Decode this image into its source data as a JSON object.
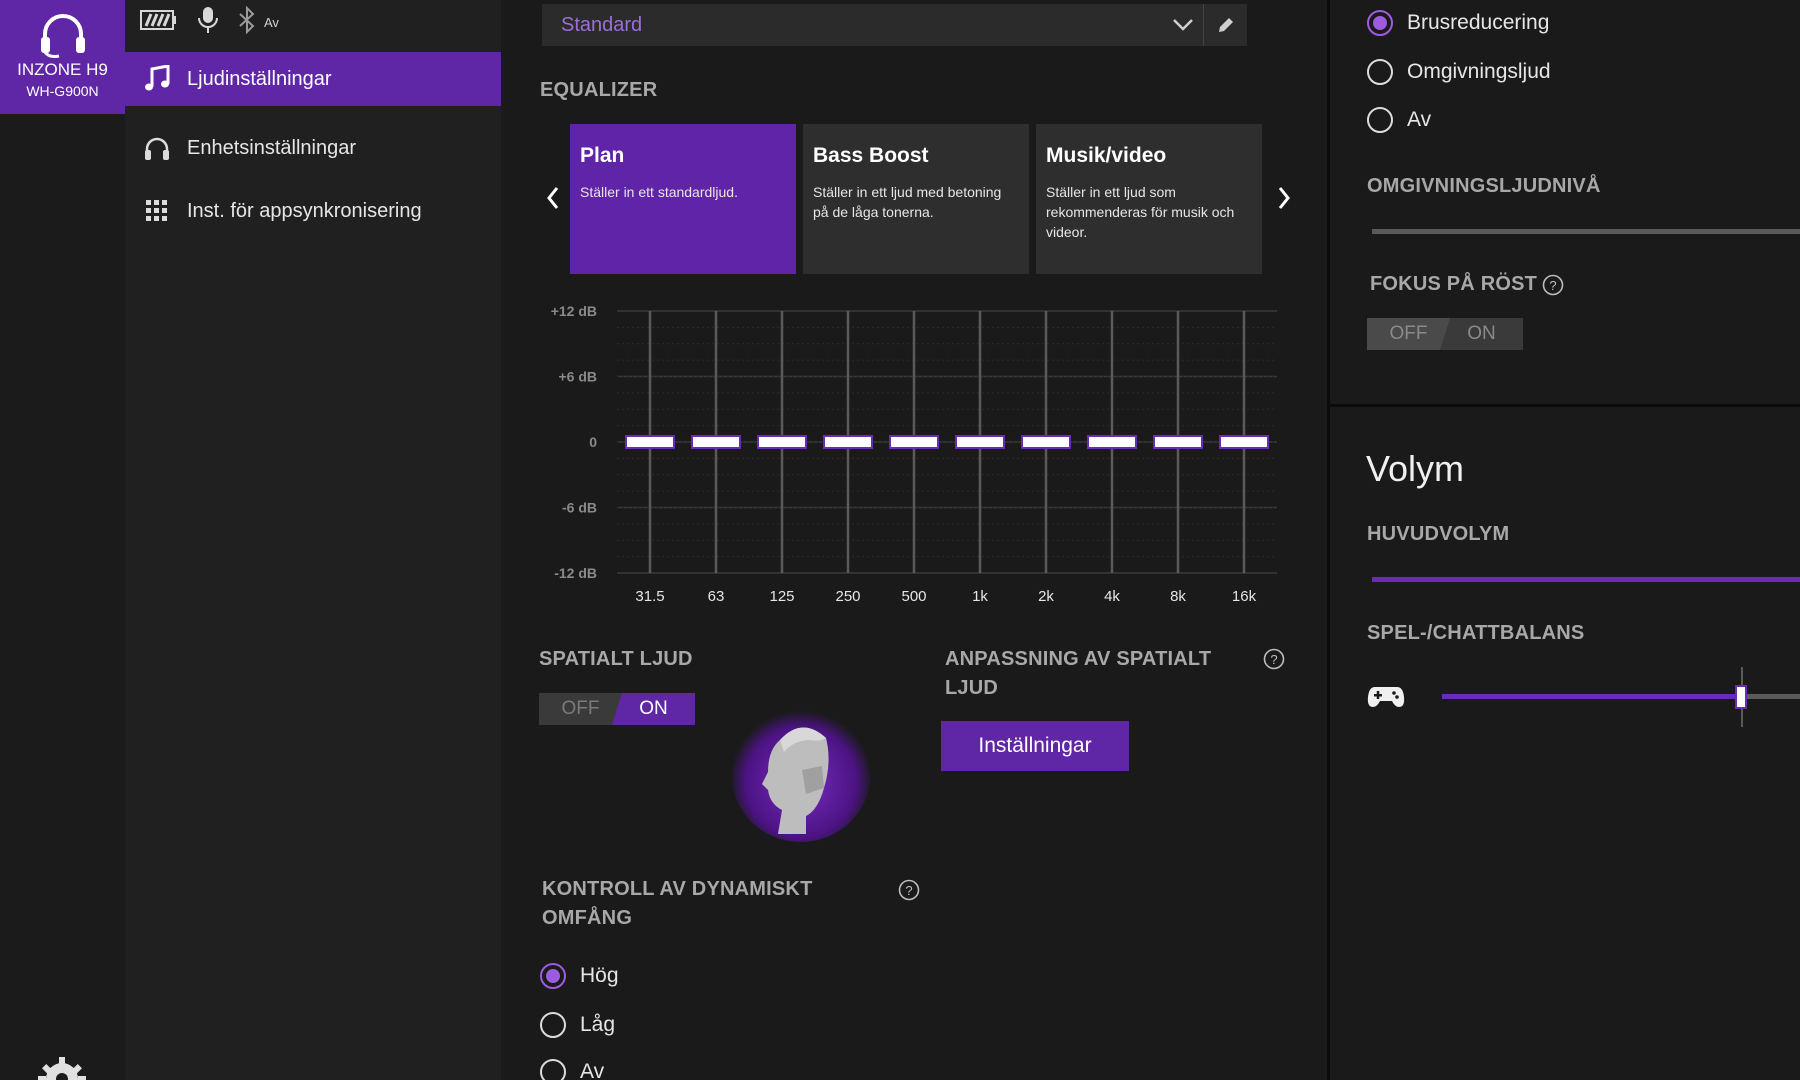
{
  "device": {
    "name": "INZONE H9",
    "model": "WH-G900N"
  },
  "status": {
    "bluetooth_state": "Av"
  },
  "nav": [
    {
      "label": "Ljudinställningar",
      "icon": "music-note-icon",
      "active": true
    },
    {
      "label": "Enhetsinställningar",
      "icon": "headphones-icon",
      "active": false
    },
    {
      "label": "Inst. för appsynkronisering",
      "icon": "grid-icon",
      "active": false
    }
  ],
  "preset": {
    "selected": "Standard"
  },
  "equalizer": {
    "title": "EQUALIZER",
    "cards": [
      {
        "title": "Plan",
        "desc": "Ställer in ett standardljud.",
        "active": true
      },
      {
        "title": "Bass Boost",
        "desc": "Ställer in ett ljud med betoning på de låga tonerna.",
        "active": false
      },
      {
        "title": "Musik/video",
        "desc": "Ställer in ett ljud som rekommenderas för musik och videor.",
        "active": false
      }
    ]
  },
  "chart_data": {
    "type": "bar",
    "categories": [
      "31.5",
      "63",
      "125",
      "250",
      "500",
      "1k",
      "2k",
      "4k",
      "8k",
      "16k"
    ],
    "values": [
      0,
      0,
      0,
      0,
      0,
      0,
      0,
      0,
      0,
      0
    ],
    "y_ticks": [
      "+12 dB",
      "+6 dB",
      "0",
      "-6 dB",
      "-12 dB"
    ],
    "ylim": [
      -12,
      12
    ],
    "title": "",
    "xlabel": "",
    "ylabel": "",
    "grid": true
  },
  "spatial": {
    "title": "SPATIALT LJUD",
    "toggle_off": "OFF",
    "toggle_on": "ON",
    "state": "on",
    "adapt_title": "ANPASSNING AV SPATIALT LJUD",
    "settings_button": "Inställningar"
  },
  "dynamic": {
    "title": "KONTROLL AV DYNAMISKT OMFÅNG",
    "options": [
      {
        "label": "Hög",
        "checked": true
      },
      {
        "label": "Låg",
        "checked": false
      },
      {
        "label": "Av",
        "checked": false
      }
    ]
  },
  "noise": {
    "options": [
      {
        "label": "Brusreducering",
        "checked": true
      },
      {
        "label": "Omgivningsljud",
        "checked": false
      },
      {
        "label": "Av",
        "checked": false
      }
    ],
    "ambient_level_title": "OMGIVNINGSLJUDNIVÅ",
    "voice_focus_title": "FOKUS PÅ RÖST",
    "voice_toggle_off": "OFF",
    "voice_toggle_on": "ON",
    "voice_state": "off"
  },
  "volume": {
    "title": "Volym",
    "master_title": "HUVUDVOLYM",
    "balance_title": "SPEL-/CHATTBALANS"
  },
  "colors": {
    "accent": "#5f26a6",
    "accent_light": "#9c5be0",
    "eq_handle": "#ffffff"
  }
}
